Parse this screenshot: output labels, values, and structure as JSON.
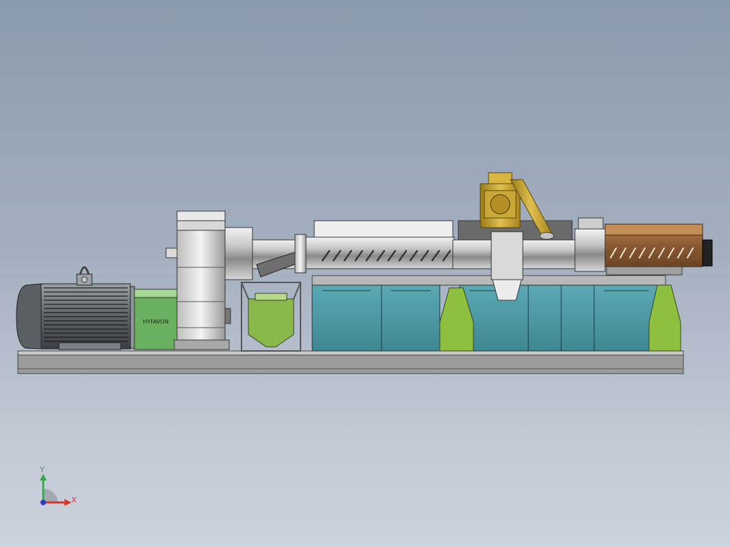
{
  "viewport": {
    "background_top": "#8c9aad",
    "background_bottom": "#cdd3dd"
  },
  "machine": {
    "motor_color": "#555a5e",
    "gearbox_label": "HYFAVON",
    "gearbox_color": "#69b060",
    "hopper_color": "#8ab84a",
    "tank_color": "#4797a3",
    "heater_color": "#8a5a32",
    "feeder_color": "#c9a227",
    "support_color": "#8fbf3e"
  },
  "triad": {
    "x_label": "X",
    "y_label": "Y",
    "x_color": "#d8352b",
    "y_color": "#3aa84a",
    "z_color": "#2c39c8"
  }
}
